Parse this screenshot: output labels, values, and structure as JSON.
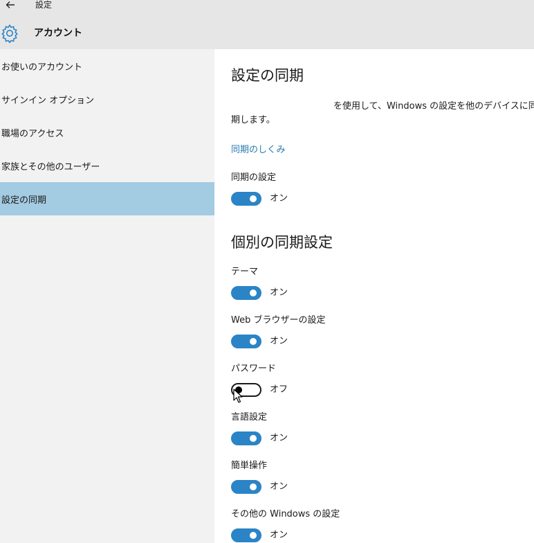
{
  "window": {
    "title": "設定",
    "back_icon": "back-arrow-icon"
  },
  "header": {
    "icon": "gear-icon",
    "title": "アカウント",
    "accent": "#2b84c6"
  },
  "sidebar": {
    "items": [
      {
        "label": "お使いのアカウント",
        "selected": false
      },
      {
        "label": "サインイン オプション",
        "selected": false
      },
      {
        "label": "職場のアクセス",
        "selected": false
      },
      {
        "label": "家族とその他のユーザー",
        "selected": false
      },
      {
        "label": "設定の同期",
        "selected": true
      }
    ],
    "selected_color": "#a3cbe2"
  },
  "main": {
    "title": "設定の同期",
    "description_line1": "を使用して、Windows の設定を他のデバイスに同",
    "description_line2": "期します。",
    "link": "同期のしくみ",
    "sync_setting": {
      "label": "同期の設定",
      "state": "オン",
      "on": true
    },
    "section_title": "個別の同期設定",
    "items": [
      {
        "label": "テーマ",
        "state": "オン",
        "on": true
      },
      {
        "label": "Web ブラウザーの設定",
        "state": "オン",
        "on": true
      },
      {
        "label": "パスワード",
        "state": "オフ",
        "on": false
      },
      {
        "label": "言語設定",
        "state": "オン",
        "on": true
      },
      {
        "label": "簡単操作",
        "state": "オン",
        "on": true
      },
      {
        "label": "その他の Windows の設定",
        "state": "オン",
        "on": true
      }
    ]
  }
}
